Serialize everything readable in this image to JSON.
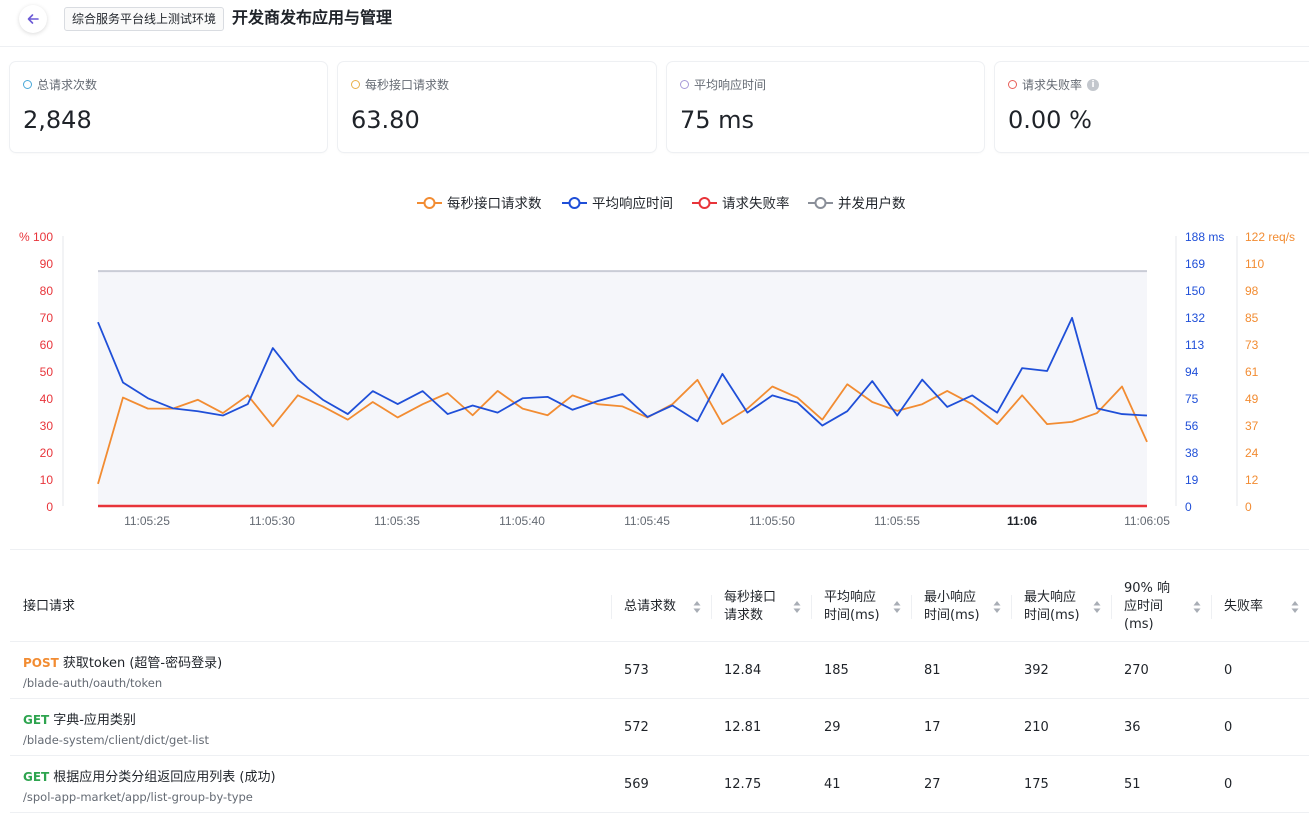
{
  "header": {
    "env_tag": "综合服务平台线上测试环境",
    "title": "开发商发布应用与管理"
  },
  "stats": [
    {
      "label": "总请求次数",
      "value": "2,848",
      "color": "#4aa8d8"
    },
    {
      "label": "每秒接口请求数",
      "value": "63.80",
      "color": "#e8b04a"
    },
    {
      "label": "平均响应时间",
      "value": "75 ms",
      "color": "#a79ad8"
    },
    {
      "label": "请求失败率",
      "value": "0.00 %",
      "color": "#e8605a",
      "info_icon": "info-icon"
    }
  ],
  "chart_data": {
    "type": "line",
    "legend": [
      "每秒接口请求数",
      "平均响应时间",
      "请求失败率",
      "并发用户数"
    ],
    "legend_position": "top-center",
    "x_ticks": [
      "11:05:25",
      "11:05:30",
      "11:05:35",
      "11:05:40",
      "11:05:45",
      "11:05:50",
      "11:05:55",
      "11:06",
      "11:06:05"
    ],
    "y_left": {
      "unit_label": "% 100",
      "ticks": [
        "90",
        "80",
        "70",
        "60",
        "50",
        "40",
        "30",
        "20",
        "10",
        "0"
      ],
      "range": [
        0,
        100
      ],
      "color": "#e8343a"
    },
    "y_right_ms": {
      "ticks": [
        "188 ms",
        "169",
        "150",
        "132",
        "113",
        "94",
        "75",
        "56",
        "38",
        "19",
        "0"
      ],
      "range": [
        0,
        188
      ],
      "color": "#1f4fd8"
    },
    "y_right_req": {
      "ticks": [
        "122 req/s",
        "110",
        "98",
        "85",
        "73",
        "61",
        "49",
        "37",
        "24",
        "12",
        "0"
      ],
      "range": [
        0,
        122
      ],
      "color": "#f28c32"
    },
    "series": [
      {
        "name": "每秒接口请求数",
        "color": "#f28c32",
        "axis": "req",
        "values": [
          10,
          49,
          44,
          44,
          48,
          42,
          50,
          36,
          50,
          45,
          39,
          47,
          40,
          46,
          51,
          41,
          52,
          44,
          41,
          50,
          46,
          45,
          40,
          46,
          57,
          37,
          44,
          54,
          49,
          39,
          55,
          47,
          43,
          46,
          52,
          46,
          37,
          50,
          37,
          38,
          42,
          54,
          29
        ]
      },
      {
        "name": "平均响应时间",
        "color": "#1f4fd8",
        "axis": "ms",
        "values": [
          128,
          86,
          75,
          68,
          66,
          63,
          71,
          110,
          88,
          74,
          64,
          80,
          71,
          80,
          64,
          70,
          65,
          75,
          76,
          67,
          73,
          78,
          62,
          70,
          59,
          92,
          65,
          77,
          72,
          56,
          66,
          87,
          63,
          88,
          69,
          77,
          65,
          96,
          94,
          131,
          68,
          64,
          63
        ]
      },
      {
        "name": "请求失败率",
        "color": "#e8343a",
        "axis": "pct",
        "values": [
          0,
          0,
          0,
          0,
          0,
          0,
          0,
          0,
          0,
          0,
          0,
          0,
          0,
          0,
          0,
          0,
          0,
          0,
          0,
          0,
          0,
          0,
          0,
          0,
          0,
          0,
          0,
          0,
          0,
          0,
          0,
          0,
          0,
          0,
          0,
          0,
          0,
          0,
          0,
          0,
          0,
          0,
          0
        ]
      },
      {
        "name": "并发用户数",
        "color": "#8a8f99",
        "axis": "pct",
        "values": [
          87,
          87,
          87,
          87,
          87,
          87,
          87,
          87,
          87,
          87,
          87,
          87,
          87,
          87,
          87,
          87,
          87,
          87,
          87,
          87,
          87,
          87,
          87,
          87,
          87,
          87,
          87,
          87,
          87,
          87,
          87,
          87,
          87,
          87,
          87,
          87,
          87,
          87,
          87,
          87,
          87,
          87,
          87
        ]
      }
    ]
  },
  "table": {
    "columns": [
      "接口请求",
      "总请求数",
      "每秒接口\n请求数",
      "平均响应\n时间(ms)",
      "最小响应\n时间(ms)",
      "最大响应\n时间(ms)",
      "90% 响\n应时间\n(ms)",
      "失败率"
    ],
    "rows": [
      {
        "method": "POST",
        "method_color": "#f28c32",
        "name": "获取token (超管-密码登录)",
        "path": "/blade-auth/oauth/token",
        "values": [
          "573",
          "12.84",
          "185",
          "81",
          "392",
          "270",
          "0"
        ]
      },
      {
        "method": "GET",
        "method_color": "#2ea44f",
        "name": "字典-应用类别",
        "path": "/blade-system/client/dict/get-list",
        "values": [
          "572",
          "12.81",
          "29",
          "17",
          "210",
          "36",
          "0"
        ]
      },
      {
        "method": "GET",
        "method_color": "#2ea44f",
        "name": "根据应用分类分组返回应用列表 (成功)",
        "path": "/spol-app-market/app/list-group-by-type",
        "values": [
          "569",
          "12.75",
          "41",
          "27",
          "175",
          "51",
          "0"
        ]
      }
    ]
  }
}
